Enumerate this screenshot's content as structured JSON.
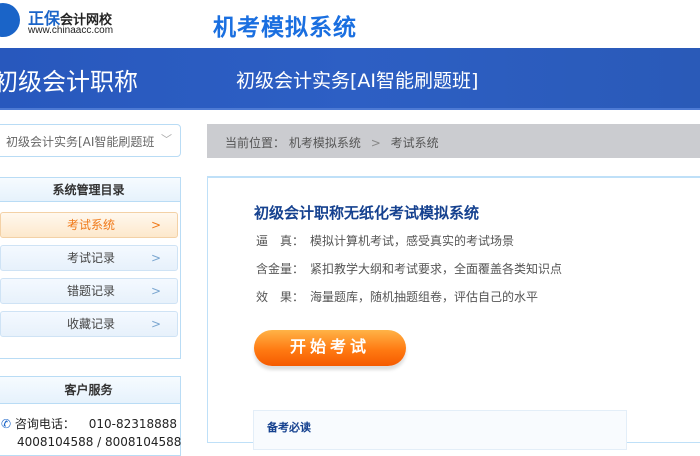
{
  "header": {
    "brand": "正保",
    "brand_sub": "会计网校",
    "url": "www.chinaacc.com",
    "system_title": "机考模拟系统"
  },
  "banner": {
    "category": "初级会计职称",
    "course": "初级会计实务[AI智能刷题班]"
  },
  "sidebar": {
    "course_select": "初级会计实务[AI智能刷题班",
    "menu_title": "系统管理目录",
    "items": [
      {
        "label": "考试系统"
      },
      {
        "label": "考试记录"
      },
      {
        "label": "错题记录"
      },
      {
        "label": "收藏记录"
      }
    ],
    "service_title": "客户服务",
    "phone_label": "咨询电话：",
    "phone": "010-82318888",
    "phone2": "4008104588 / 8008104588"
  },
  "breadcrumb": {
    "prefix": "当前位置：",
    "items": [
      "机考模拟系统",
      "考试系统"
    ],
    "sep": ">"
  },
  "main": {
    "title": "初级会计职称无纸化考试模拟系统",
    "features": [
      {
        "key": "逼　真：",
        "value": "模拟计算机考试，感受真实的考试场景"
      },
      {
        "key": "含金量：",
        "value": "紧扣教学大纲和考试要求，全面覆盖各类知识点"
      },
      {
        "key": "效　果：",
        "value": "海量题库，随机抽题组卷，评估自己的水平"
      }
    ],
    "start_button": "开始考试",
    "must_read": "备考必读"
  }
}
